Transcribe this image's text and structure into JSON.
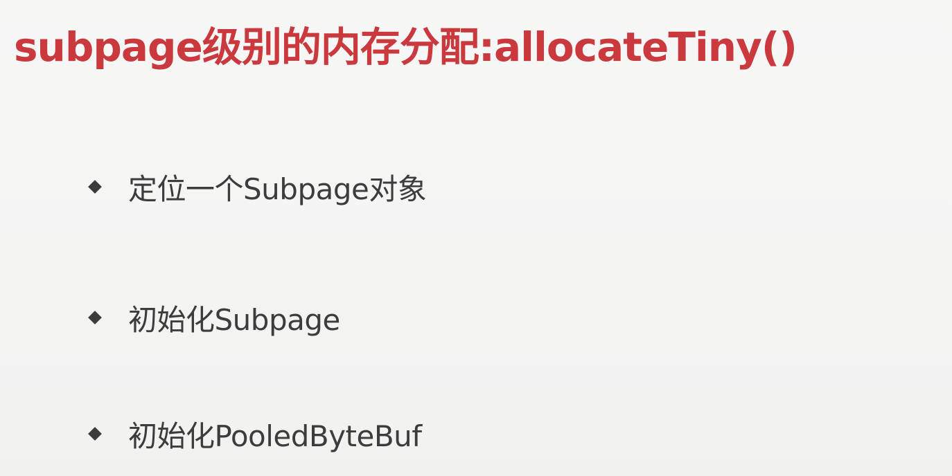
{
  "slide": {
    "title": "subpage级别的内存分配:allocateTiny()",
    "bullets": [
      {
        "text": "定位一个Subpage对象"
      },
      {
        "text": "初始化Subpage"
      },
      {
        "text": "初始化PooledByteBuf"
      }
    ]
  },
  "colors": {
    "title": "#c9393d",
    "text": "#3c3c3c",
    "background": "#f5f5f4"
  },
  "icons": {
    "bullet_marker": "diamond-bullet-icon"
  }
}
